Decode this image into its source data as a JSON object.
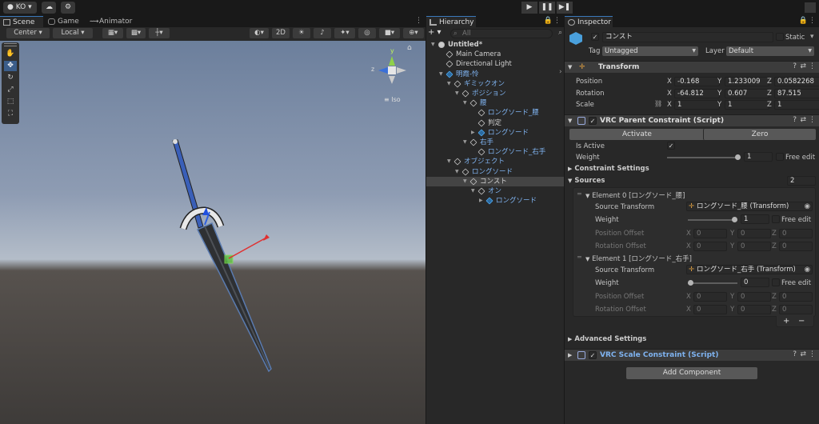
{
  "topbar": {
    "account": "KO",
    "play": "▶",
    "pause": "❚❚",
    "step": "▶❚"
  },
  "scene_panel": {
    "tabs": [
      "Scene",
      "Game",
      "Animator"
    ],
    "toolbar": {
      "pivot": "Center",
      "space": "Local",
      "mode_2d": "2D"
    },
    "gizmo": {
      "x": "x",
      "y": "y",
      "z": "z",
      "projection": "Iso"
    }
  },
  "hierarchy": {
    "tab": "Hierarchy",
    "add": "+ ▾",
    "search_placeholder": "All",
    "items": [
      {
        "label": "Untitled*",
        "depth": 0,
        "icon": "unity-scene-icon",
        "fold": "open",
        "bold": true
      },
      {
        "label": "Main Camera",
        "depth": 1,
        "icon": "gameobject-icon"
      },
      {
        "label": "Directional Light",
        "depth": 1,
        "icon": "gameobject-icon"
      },
      {
        "label": "明霞-怜",
        "depth": 1,
        "icon": "prefab-icon",
        "fold": "open",
        "blue": true
      },
      {
        "label": "ギミックオン",
        "depth": 2,
        "icon": "gameobject-icon",
        "fold": "open",
        "blue": true
      },
      {
        "label": "ポジション",
        "depth": 3,
        "icon": "gameobject-icon",
        "fold": "open",
        "blue": true
      },
      {
        "label": "腰",
        "depth": 4,
        "icon": "gameobject-icon",
        "fold": "open",
        "blue": true
      },
      {
        "label": "ロングソード_腰",
        "depth": 5,
        "icon": "gameobject-icon",
        "blue": true
      },
      {
        "label": "判定",
        "depth": 5,
        "icon": "gameobject-icon"
      },
      {
        "label": "ロングソード",
        "depth": 5,
        "icon": "prefab-icon",
        "fold": "closed",
        "blue": true
      },
      {
        "label": "右手",
        "depth": 4,
        "icon": "gameobject-icon",
        "fold": "open",
        "blue": true
      },
      {
        "label": "ロングソード_右手",
        "depth": 5,
        "icon": "gameobject-icon",
        "blue": true
      },
      {
        "label": "オブジェクト",
        "depth": 2,
        "icon": "gameobject-icon",
        "fold": "open",
        "blue": true
      },
      {
        "label": "ロングソード",
        "depth": 3,
        "icon": "gameobject-icon",
        "fold": "open",
        "blue": true
      },
      {
        "label": "コンスト",
        "depth": 4,
        "icon": "gameobject-icon",
        "fold": "open",
        "selected": true
      },
      {
        "label": "オン",
        "depth": 5,
        "icon": "gameobject-icon",
        "fold": "open",
        "blue": true
      },
      {
        "label": "ロングソード",
        "depth": 6,
        "icon": "prefab-icon",
        "fold": "closed",
        "blue": true
      }
    ]
  },
  "inspector": {
    "tab": "Inspector",
    "object": {
      "name": "コンスト",
      "static_label": "Static",
      "tag_label": "Tag",
      "tag": "Untagged",
      "layer_label": "Layer",
      "layer": "Default"
    },
    "transform": {
      "title": "Transform",
      "position_label": "Position",
      "position": [
        "-0.168",
        "1.233009",
        "0.0582268"
      ],
      "rotation_label": "Rotation",
      "rotation": [
        "-64.812",
        "0.607",
        "87.515"
      ],
      "scale_label": "Scale",
      "scale": [
        "1",
        "1",
        "1"
      ]
    },
    "parent_constraint": {
      "title": "VRC Parent Constraint (Script)",
      "activate": "Activate",
      "zero": "Zero",
      "is_active_label": "Is Active",
      "weight_label": "Weight",
      "weight": "1",
      "weight_fraction": 1.0,
      "free_edit": "Free edit",
      "constraint_settings": "Constraint Settings",
      "sources_label": "Sources",
      "sources_count": "2",
      "elements": [
        {
          "header": "Element 0 [ロングソード_腰]",
          "source_label": "Source Transform",
          "source": "ロングソード_腰 (Transform)",
          "weight_label": "Weight",
          "weight": "1",
          "weight_fraction": 1.0,
          "free_edit": "Free edit",
          "pos_label": "Position Offset",
          "rot_label": "Rotation Offset",
          "pos": [
            "0",
            "0",
            "0"
          ],
          "rot": [
            "0",
            "0",
            "0"
          ]
        },
        {
          "header": "Element 1 [ロングソード_右手]",
          "source_label": "Source Transform",
          "source": "ロングソード_右手 (Transform)",
          "weight_label": "Weight",
          "weight": "0",
          "weight_fraction": 0.0,
          "free_edit": "Free edit",
          "pos_label": "Position Offset",
          "rot_label": "Rotation Offset",
          "pos": [
            "0",
            "0",
            "0"
          ],
          "rot": [
            "0",
            "0",
            "0"
          ]
        }
      ],
      "plus": "+",
      "minus": "−",
      "advanced": "Advanced Settings"
    },
    "scale_constraint": {
      "title": "VRC Scale Constraint (Script)"
    },
    "add_component": "Add Component"
  },
  "colors": {
    "accent": "#3a79bb",
    "blue_text": "#7fb3f0",
    "panel": "#282828"
  }
}
